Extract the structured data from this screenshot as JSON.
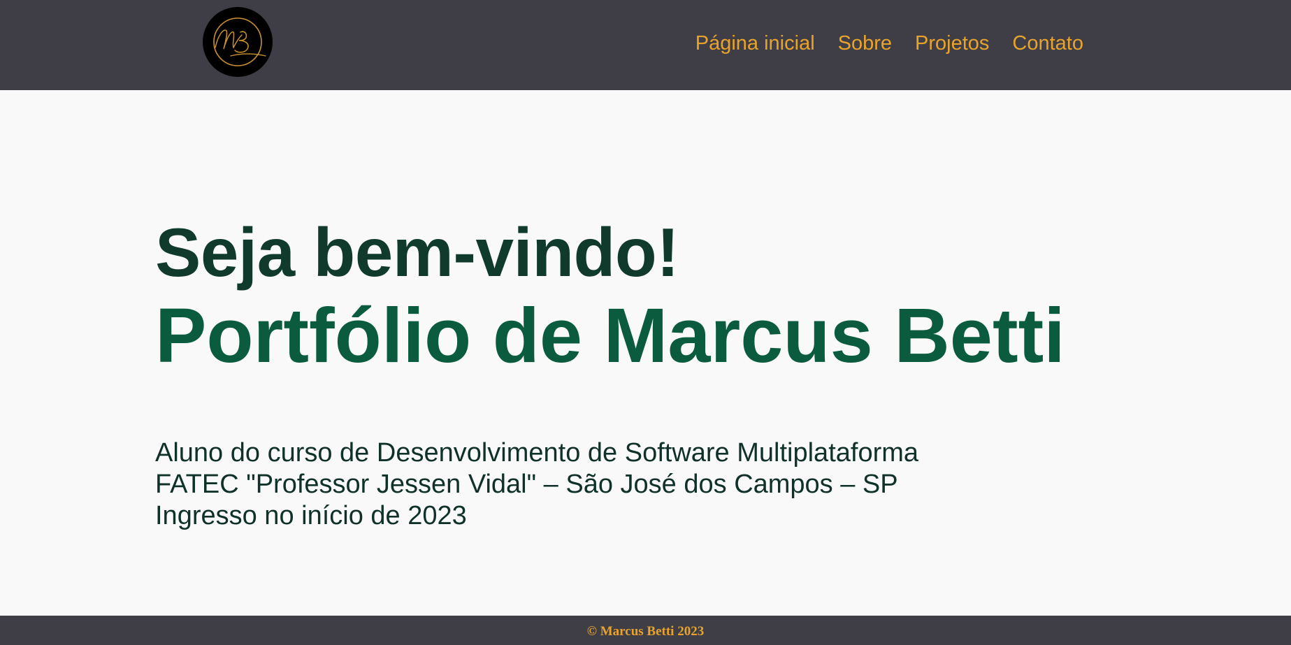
{
  "header": {
    "logo_text": "MB",
    "logo_icon": "monogram-logo-icon",
    "nav": [
      {
        "label": "Página inicial"
      },
      {
        "label": "Sobre"
      },
      {
        "label": "Projetos"
      },
      {
        "label": "Contato"
      }
    ]
  },
  "hero": {
    "greeting": "Seja bem-vindo!",
    "title": "Portfólio de Marcus Betti",
    "info_lines": [
      "Aluno do curso de Desenvolvimento de Software Multiplataforma",
      "FATEC \"Professor Jessen Vidal\" – São José dos Campos – SP",
      "Ingresso no início de 2023"
    ]
  },
  "footer": {
    "copyright": "© Marcus Betti 2023"
  },
  "colors": {
    "header_bg": "#3f3e46",
    "accent": "#e8a32b",
    "page_bg": "#f9f9f9",
    "greeting_color": "#103a2c",
    "title_color": "#0b5c3f",
    "text_color": "#10312a"
  }
}
